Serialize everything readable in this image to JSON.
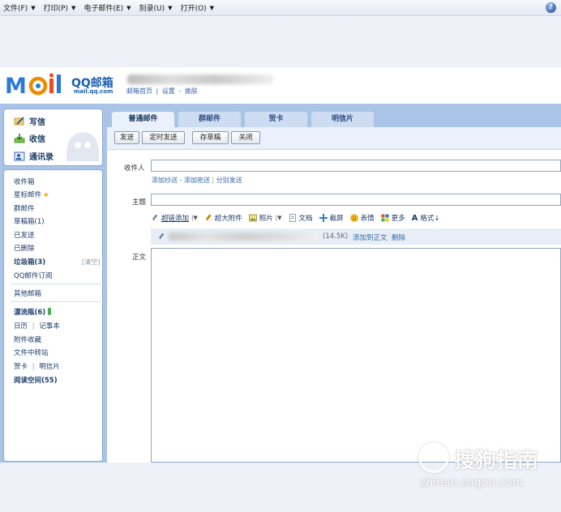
{
  "menubar": {
    "items": [
      {
        "label": "文件(F)"
      },
      {
        "label": "打印(P)"
      },
      {
        "label": "电子邮件(E)"
      },
      {
        "label": "刻录(U)"
      },
      {
        "label": "打开(O)"
      }
    ],
    "help": "?"
  },
  "header": {
    "logo_title": "QQ邮箱",
    "logo_domain": "mail.qq.com",
    "links": {
      "home": "邮箱首页",
      "sep": "|",
      "settings": "设置",
      "dash": "-",
      "skin": "换肤"
    }
  },
  "sidebar": {
    "compose": {
      "write": "写信",
      "receive": "收信",
      "contacts": "通讯录"
    },
    "folders": {
      "inbox": "收件箱",
      "starred": "星标邮件",
      "star_glyph": "★",
      "group": "群邮件",
      "drafts": "草稿箱(1)",
      "sent": "已发送",
      "deleted": "已删除",
      "junk": "垃圾箱(3)",
      "clear": "[清空]",
      "subscribe": "QQ邮件订阅",
      "other": "其他邮箱",
      "drift_bottle": "漂流瓶(6)",
      "calendar": "日历",
      "notebook": "记事本",
      "attachments": "附件收藏",
      "file_transfer": "文件中转站",
      "greeting_card": "贺卡",
      "postcard": "明信片",
      "reading": "阅读空间(55)",
      "divider": "|"
    }
  },
  "tabs": [
    {
      "label": "普通邮件",
      "active": true
    },
    {
      "label": "群邮件",
      "active": false
    },
    {
      "label": "贺卡",
      "active": false
    },
    {
      "label": "明信片",
      "active": false
    }
  ],
  "buttons": {
    "send": "发送",
    "timed_send": "定时发送",
    "save_draft": "存草稿",
    "close": "关闭"
  },
  "compose_form": {
    "to_label": "收件人",
    "recipient_links": {
      "cc": "添加抄送",
      "bcc": "添加密送",
      "separate": "分别发送",
      "dash": "-",
      "sep": "|"
    },
    "subject_label": "主题",
    "body_label": "正文",
    "toolbar": {
      "super_add": "超链添加",
      "big_attach": "超大附件",
      "photo": "照片",
      "doc": "文档",
      "screenshot": "截屏",
      "emoji": "表情",
      "more": "更多",
      "format": "格式↓"
    },
    "attachment": {
      "size": "(14.5K)",
      "add_to_body": "添加到正文",
      "delete": "删除"
    }
  },
  "watermark": {
    "text": "搜狗指南",
    "url": "zhinan.sogou.com"
  },
  "colors": {
    "accent_blue": "#a9c4e6",
    "link": "#3366aa",
    "brand_blue": "#1a5fb4"
  }
}
